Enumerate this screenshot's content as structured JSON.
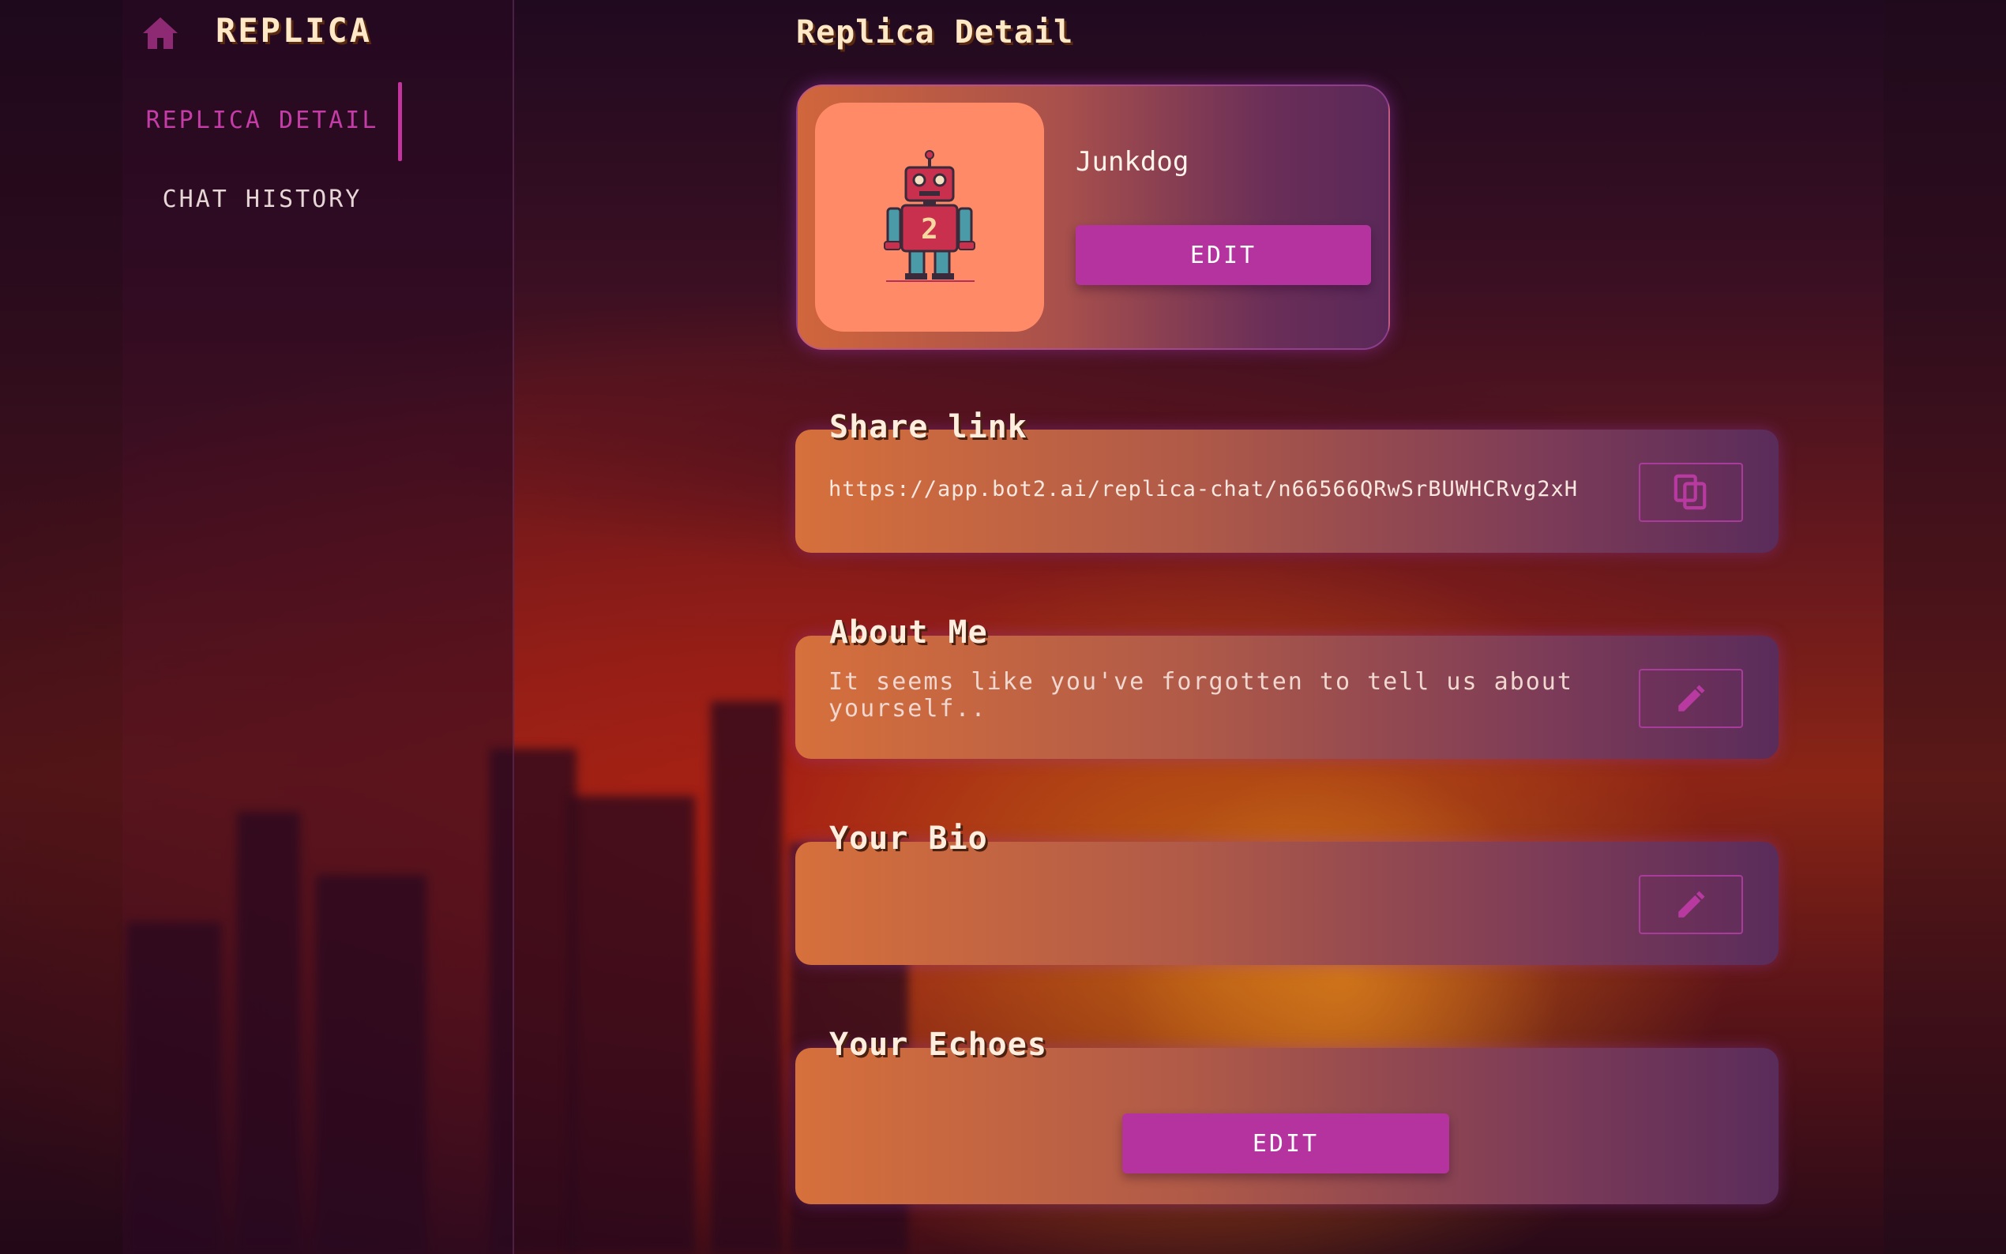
{
  "brand": {
    "title": "REPLICA",
    "home_icon": "home-icon"
  },
  "sidebar": {
    "items": [
      {
        "label": "REPLICA DETAIL",
        "active": true
      },
      {
        "label": "CHAT HISTORY",
        "active": false
      }
    ]
  },
  "page": {
    "title": "Replica Detail"
  },
  "profile": {
    "name": "Junkdog",
    "edit_label": "EDIT",
    "avatar_icon": "robot-avatar"
  },
  "share": {
    "title": "Share link",
    "url": "https://app.bot2.ai/replica-chat/n66566QRwSrBUWHCRvg2xH",
    "copy_icon": "copy-icon"
  },
  "about": {
    "title": "About Me",
    "text": "It seems like you've forgotten to tell us about yourself..",
    "edit_icon": "pencil-icon"
  },
  "bio": {
    "title": "Your Bio",
    "text": "",
    "edit_icon": "pencil-icon"
  },
  "echoes": {
    "title": "Your Echoes",
    "edit_label": "EDIT"
  },
  "colors": {
    "accent": "#b4339e",
    "active_nav": "#c43ca6",
    "title_text": "#ffe8c6"
  }
}
